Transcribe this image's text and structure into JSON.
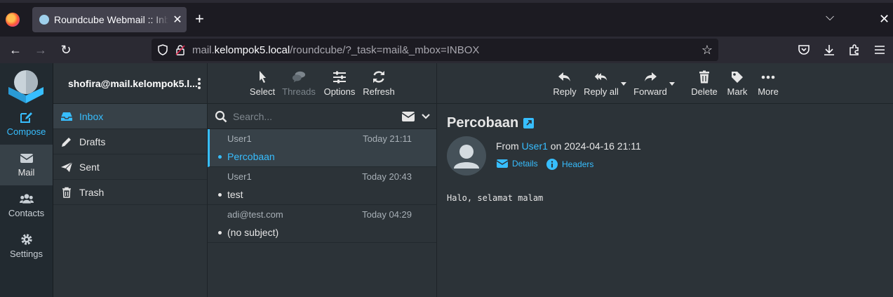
{
  "browser": {
    "tab_title": "Roundcube Webmail :: Inbox",
    "new_tab_label": "+",
    "url_prefix": "mail.",
    "url_host": "kelompok5.local",
    "url_path": "/roundcube/?_task=mail&_mbox=INBOX"
  },
  "taskbar": {
    "compose": "Compose",
    "mail": "Mail",
    "contacts": "Contacts",
    "settings": "Settings"
  },
  "account": "shofira@mail.kelompok5.l...",
  "folders": [
    {
      "label": "Inbox"
    },
    {
      "label": "Drafts"
    },
    {
      "label": "Sent"
    },
    {
      "label": "Trash"
    }
  ],
  "list_toolbar": {
    "select": "Select",
    "threads": "Threads",
    "options": "Options",
    "refresh": "Refresh"
  },
  "search": {
    "placeholder": "Search..."
  },
  "messages": [
    {
      "from": "User1",
      "date": "Today 21:11",
      "subject": "Percobaan"
    },
    {
      "from": "User1",
      "date": "Today 20:43",
      "subject": "test"
    },
    {
      "from": "adi@test.com",
      "date": "Today 04:29",
      "subject": "(no subject)"
    }
  ],
  "view_toolbar": {
    "reply": "Reply",
    "reply_all": "Reply all",
    "forward": "Forward",
    "delete": "Delete",
    "mark": "Mark",
    "more": "More"
  },
  "message": {
    "subject": "Percobaan",
    "from_prefix": "From ",
    "from_name": "User1",
    "date_text": " on 2024-04-16 21:11",
    "details": "Details",
    "headers": "Headers",
    "body": "Halo, selamat malam"
  },
  "colors": {
    "accent": "#37beff",
    "bg": "#2c3338",
    "taskbar": "#222a30"
  }
}
